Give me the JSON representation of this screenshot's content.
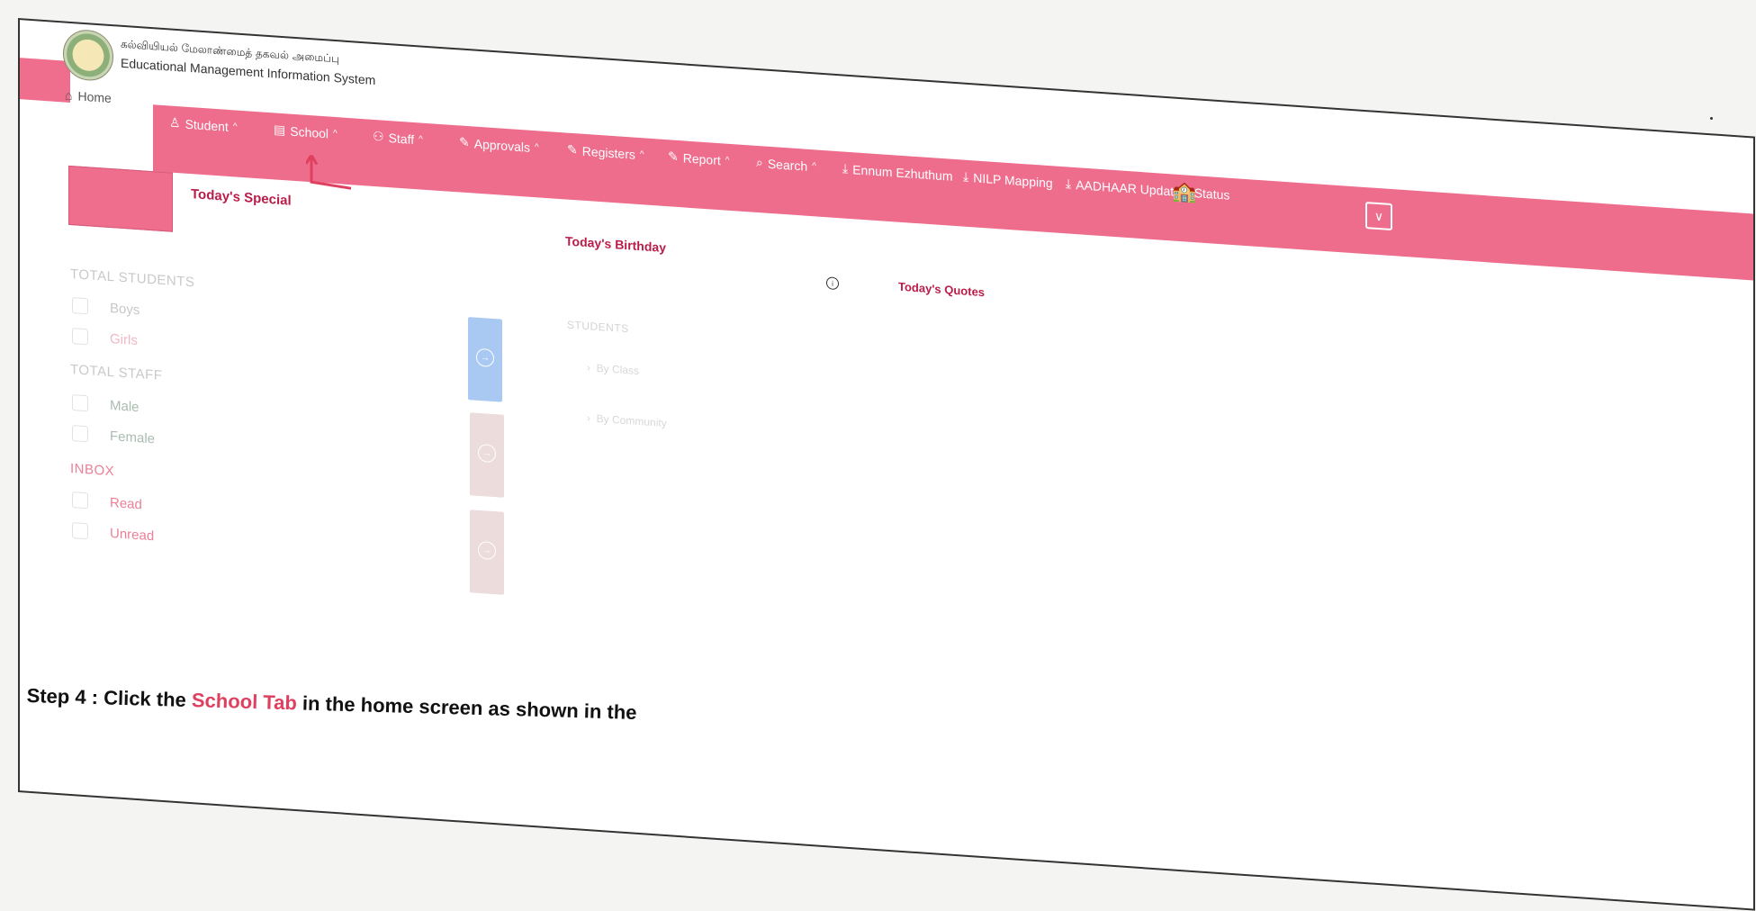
{
  "header": {
    "logo_tamil": "கல்வியியல் மேலாண்மைத் தகவல் அமைப்பு",
    "app_title": "Educational Management Information System"
  },
  "nav": {
    "home": "Home",
    "items": [
      {
        "label": "Student",
        "icon": "user-icon"
      },
      {
        "label": "School",
        "icon": "school-icon"
      },
      {
        "label": "Staff",
        "icon": "users-icon"
      },
      {
        "label": "Approvals",
        "icon": "edit-icon"
      },
      {
        "label": "Registers",
        "icon": "edit-icon"
      },
      {
        "label": "Report",
        "icon": "edit-icon"
      },
      {
        "label": "Search",
        "icon": "search-icon"
      },
      {
        "label": "Ennum Ezhuthum",
        "icon": "download-icon"
      },
      {
        "label": "NILP Mapping",
        "icon": "download-icon"
      },
      {
        "label": "AADHAAR Updation Status",
        "icon": "download-icon"
      }
    ]
  },
  "widgets": {
    "special": "Today's Special",
    "birthday": "Today's Birthday",
    "quotes": "Today's Quotes"
  },
  "stats": {
    "students_heading": "TOTAL STUDENTS",
    "boys": "Boys",
    "girls": "Girls",
    "staff_heading": "TOTAL STAFF",
    "male": "Male",
    "female": "Female",
    "inbox_heading": "INBOX",
    "read": "Read",
    "unread": "Unread"
  },
  "students_panel": {
    "label": "STUDENTS",
    "by_class": "By Class",
    "by_community": "By Community"
  },
  "caption": {
    "prefix": "Step 4 : Click the ",
    "highlight": "School Tab",
    "suffix": " in the home screen as shown in the"
  },
  "colors": {
    "nav_pink": "#ee6d8c",
    "title_red": "#b81d4a",
    "card_blue": "#a9c8f2"
  }
}
